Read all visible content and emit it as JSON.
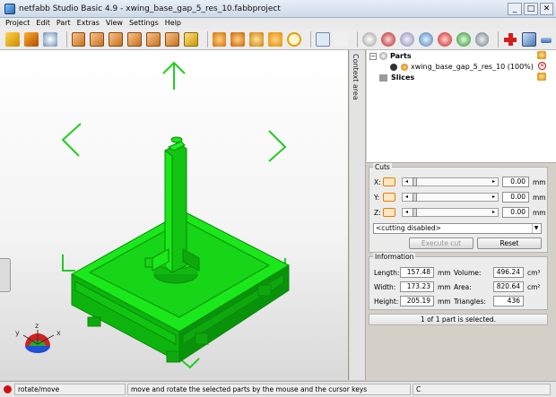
{
  "window": {
    "title": "netfabb Studio Basic 4.9 - xwing_base_gap_5_res_10.fabbproject",
    "minimize": "_",
    "maximize": "□",
    "close": "✕"
  },
  "menu": [
    "Project",
    "Edit",
    "Part",
    "Extras",
    "View",
    "Settings",
    "Help"
  ],
  "context_tab": "Context area",
  "tree": {
    "parts_label": "Parts",
    "part_name": "xwing_base_gap_5_res_10 (100%)",
    "slices_label": "Slices"
  },
  "cuts": {
    "title": "Cuts",
    "axes": [
      {
        "label": "X:",
        "value": "0.00",
        "unit": "mm"
      },
      {
        "label": "Y:",
        "value": "0.00",
        "unit": "mm"
      },
      {
        "label": "Z:",
        "value": "0.00",
        "unit": "mm"
      }
    ],
    "mode": "<cutting disabled>",
    "execute_label": "Execute cut",
    "reset_label": "Reset"
  },
  "info": {
    "title": "Information",
    "length_label": "Length:",
    "length": "157.48",
    "length_unit": "mm",
    "width_label": "Width:",
    "width": "173.23",
    "width_unit": "mm",
    "height_label": "Height:",
    "height": "205.19",
    "height_unit": "mm",
    "volume_label": "Volume:",
    "volume": "496.24",
    "volume_unit": "cm³",
    "area_label": "Area:",
    "area": "820.64",
    "area_unit": "cm²",
    "triangles_label": "Triangles:",
    "triangles": "436"
  },
  "selection_status": "1 of 1 part is selected.",
  "axes_labels": {
    "x": "x",
    "y": "y",
    "z": "z"
  },
  "statusbar": {
    "mode": "rotate/move",
    "hint": "move and rotate the selected parts by the mouse and the cursor keys",
    "coord": "C"
  },
  "colors": {
    "model": "#12e012",
    "model_dark": "#0a9e0a",
    "gizmo": "#22cc22",
    "status_icon": "#d01010"
  }
}
